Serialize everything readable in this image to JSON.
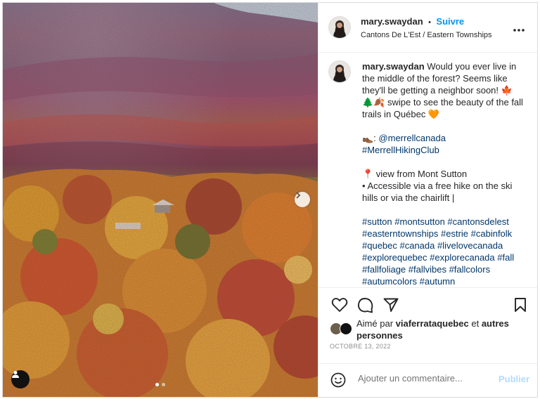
{
  "post": {
    "username": "mary.swaydan",
    "follow_label": "Suivre",
    "separator": "•",
    "location": "Cantons De L'Est / Eastern Townships",
    "caption_lines": [
      "Would you ever live in the middle of the forest? Seems like they'll be getting a neighbor soon! 🍁",
      "🌲🍂 swipe to see the beauty of the fall trails in Québec 🧡",
      "",
      "👞: ",
      "#MerrellHikingClub",
      "",
      "📍 view from Mont Sutton",
      "• Accessible via a free hike on the ski hills or via the chairlift |",
      "",
      "#sutton #montsutton #cantonsdelest #easterntownships #estrie #cabinfolk #quebec #canada #livelovecanada #explorequebec #explorecanada #fall #fallfoliage #fallvibes #fallcolors #autumcolors #autumn"
    ],
    "mention": "@merrellcanada",
    "liked_by_prefix": "Aimé par",
    "liked_by_user": "viaferrataquebec",
    "liked_by_and": "et",
    "liked_by_others": "autres personnes",
    "date": "OCTOBRE 13, 2022",
    "comment_placeholder": "Ajouter un commentaire...",
    "publish_label": "Publier"
  },
  "carousel": {
    "current": 1,
    "total": 2
  },
  "colors": {
    "link_blue": "#0095f6",
    "publish_disabled": "#b3dbff",
    "border": "#dbdbdb"
  },
  "icons": [
    "more-options-icon",
    "heart-icon",
    "comment-icon",
    "share-icon",
    "bookmark-icon",
    "emoji-icon",
    "user-tag-icon",
    "chevron-right-icon"
  ]
}
